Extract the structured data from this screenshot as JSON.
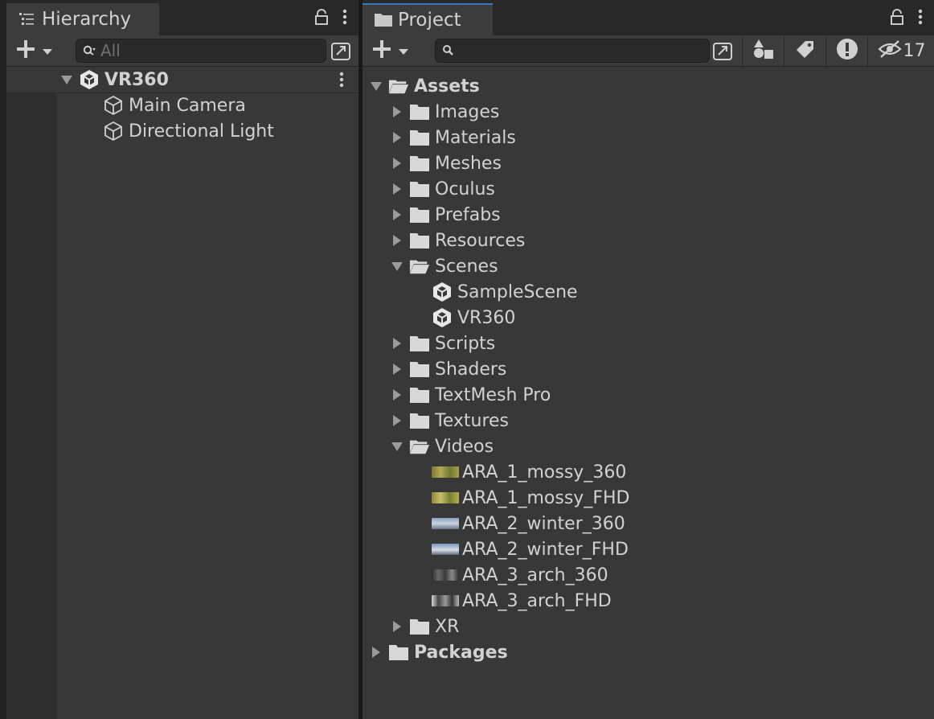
{
  "hierarchy": {
    "tab_label": "Hierarchy",
    "search_placeholder": "All",
    "scene": {
      "name": "VR360"
    },
    "objects": [
      {
        "label": "Main Camera"
      },
      {
        "label": "Directional Light"
      }
    ]
  },
  "project": {
    "tab_label": "Project",
    "search_placeholder": "",
    "hidden_count": "17",
    "root": {
      "label": "Assets"
    },
    "folders": [
      {
        "label": "Images",
        "expanded": false
      },
      {
        "label": "Materials",
        "expanded": false
      },
      {
        "label": "Meshes",
        "expanded": false
      },
      {
        "label": "Oculus",
        "expanded": false
      },
      {
        "label": "Prefabs",
        "expanded": false
      },
      {
        "label": "Resources",
        "expanded": false
      },
      {
        "label": "Scenes",
        "expanded": true
      },
      {
        "label": "Scripts",
        "expanded": false
      },
      {
        "label": "Shaders",
        "expanded": false
      },
      {
        "label": "TextMesh Pro",
        "expanded": false
      },
      {
        "label": "Textures",
        "expanded": false
      },
      {
        "label": "Videos",
        "expanded": true
      },
      {
        "label": "XR",
        "expanded": false
      }
    ],
    "scenes": [
      {
        "label": "SampleScene"
      },
      {
        "label": "VR360"
      }
    ],
    "videos": [
      {
        "label": "ARA_1_mossy_360",
        "thumb": "mossy"
      },
      {
        "label": "ARA_1_mossy_FHD",
        "thumb": "mossy"
      },
      {
        "label": "ARA_2_winter_360",
        "thumb": "winter"
      },
      {
        "label": "ARA_2_winter_FHD",
        "thumb": "winter"
      },
      {
        "label": "ARA_3_arch_360",
        "thumb": "arch"
      },
      {
        "label": "ARA_3_arch_FHD",
        "thumb": "arch"
      }
    ],
    "packages": {
      "label": "Packages"
    }
  },
  "icons": {
    "hierarchy_tab": "list-icon",
    "project_tab": "folder-icon",
    "lock": "lock-icon",
    "menu": "kebab-menu-icon",
    "add": "plus-icon",
    "search": "search-icon",
    "search_mode": "search-mode-icon",
    "type_filter": "shapes-icon",
    "label_filter": "tag-icon",
    "log_filter": "warning-icon",
    "visibility": "eye-slash-icon",
    "scene": "unity-scene-icon",
    "gameobject": "cube-icon"
  },
  "colors": {
    "panel": "#383838",
    "tab_active_accent": "#3a79bb",
    "thumb_mossy": "#8a8a3c",
    "thumb_winter": "#7d94b0",
    "thumb_arch": "#555555"
  }
}
